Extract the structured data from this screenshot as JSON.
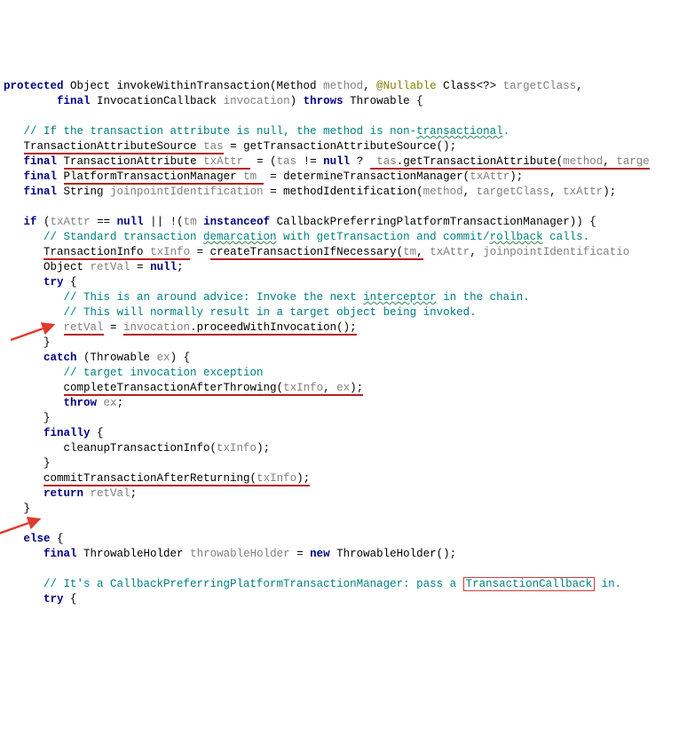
{
  "lines": {
    "l1a": "protected",
    "l1b": " Object invokeWithinTransaction(Method ",
    "l1c": "method",
    "l1d": ", ",
    "l1e": "@Nullable",
    "l1f": " Class<?> ",
    "l1g": "targetClass",
    "l1h": ",",
    "l2a": "final",
    "l2b": " InvocationCallback ",
    "l2c": "invocation",
    "l2d": ") ",
    "l2e": "throws",
    "l2f": " Throwable {",
    "l3a": "// If the transaction attribute is null, the method is non-",
    "l3b": "transactional",
    "l3c": ".",
    "l4a": "TransactionAttributeSource",
    "l4b": "tas",
    "l4c": " = getTransactionAttributeSource();",
    "l5a": "final",
    "l5b": "TransactionAttribute",
    "l5c": "txAttr",
    "l5d": " = (",
    "l5e": "tas",
    "l5f": " != ",
    "l5g": "null",
    "l5h": " ? ",
    "l5i": "tas",
    "l5j": ".getTransactionAttribute(",
    "l5k": "method",
    "l5l": ", ",
    "l5m": "targe",
    "l6a": "final",
    "l6b": "PlatformTransactionManager",
    "l6c": "tm",
    "l6d": " = determineTransactionManager(",
    "l6e": "txAttr",
    "l6f": ");",
    "l7a": "final",
    "l7b": " String ",
    "l7c": "joinpointIdentification",
    "l7d": " = methodIdentification(",
    "l7e": "method",
    "l7f": ", ",
    "l7g": "targetClass",
    "l7h": ", ",
    "l7i": "txAttr",
    "l7j": ");",
    "l8a": "if",
    "l8b": " (",
    "l8c": "txAttr",
    "l8d": " == ",
    "l8e": "null",
    "l8f": " || !(",
    "l8g": "tm",
    "l8h": " ",
    "l8i": "instanceof",
    "l8j": " CallbackPreferringPlatformTransactionManager)) {",
    "l9a": "// Standard transaction ",
    "l9b": "demarcation",
    "l9c": " with getTransaction and commit/",
    "l9d": "rollback",
    "l9e": " calls.",
    "l10a": "TransactionInfo",
    "l10b": "txInfo",
    "l10c": " = ",
    "l10d": "createTransactionIfNecessary(",
    "l10e": "tm",
    "l10f": ",",
    "l10g": " ",
    "l10h": "txAttr",
    "l10i": ", ",
    "l10j": "joinpointIdentificatio",
    "l11a": "Object ",
    "l11b": "retVal",
    "l11c": " = ",
    "l11d": "null",
    "l11e": ";",
    "l12a": "try",
    "l12b": " {",
    "l13a": "// This is an around advice: Invoke the next ",
    "l13b": "interceptor",
    "l13c": " in the chain.",
    "l14a": "// This will normally result in a target object being invoked.",
    "l15a": "retVal",
    "l15b": " = ",
    "l15c": "invocation",
    "l15d": ".proceedWithInvocation();",
    "l16a": "}",
    "l17a": "catch",
    "l17b": " (Throwable ",
    "l17c": "ex",
    "l17d": ") {",
    "l18a": "// target invocation exception",
    "l19a": "completeTransactionAfterThrowing(",
    "l19b": "txInfo",
    "l19c": ", ",
    "l19d": "ex",
    "l19e": ");",
    "l20a": "throw",
    "l20b": " ",
    "l20c": "ex",
    "l20d": ";",
    "l21a": "}",
    "l22a": "finally",
    "l22b": " {",
    "l23a": "cleanupTransactionInfo(",
    "l23b": "txInfo",
    "l23c": ");",
    "l24a": "}",
    "l25a": "commitTransactionAfterReturning(",
    "l25b": "txInfo",
    "l25c": ");",
    "l26a": "return",
    "l26b": " ",
    "l26c": "retVal",
    "l26d": ";",
    "l27a": "}",
    "l28a": "else",
    "l28b": " {",
    "l29a": "final",
    "l29b": " ThrowableHolder ",
    "l29c": "throwableHolder",
    "l29d": " = ",
    "l29e": "new",
    "l29f": " ThrowableHolder();",
    "l30a": "// It's a CallbackPreferringPlatformTransactionManager: pass a ",
    "l30b": "TransactionCallback",
    "l30c": " in.",
    "l31a": "try",
    "l31b": " {"
  }
}
